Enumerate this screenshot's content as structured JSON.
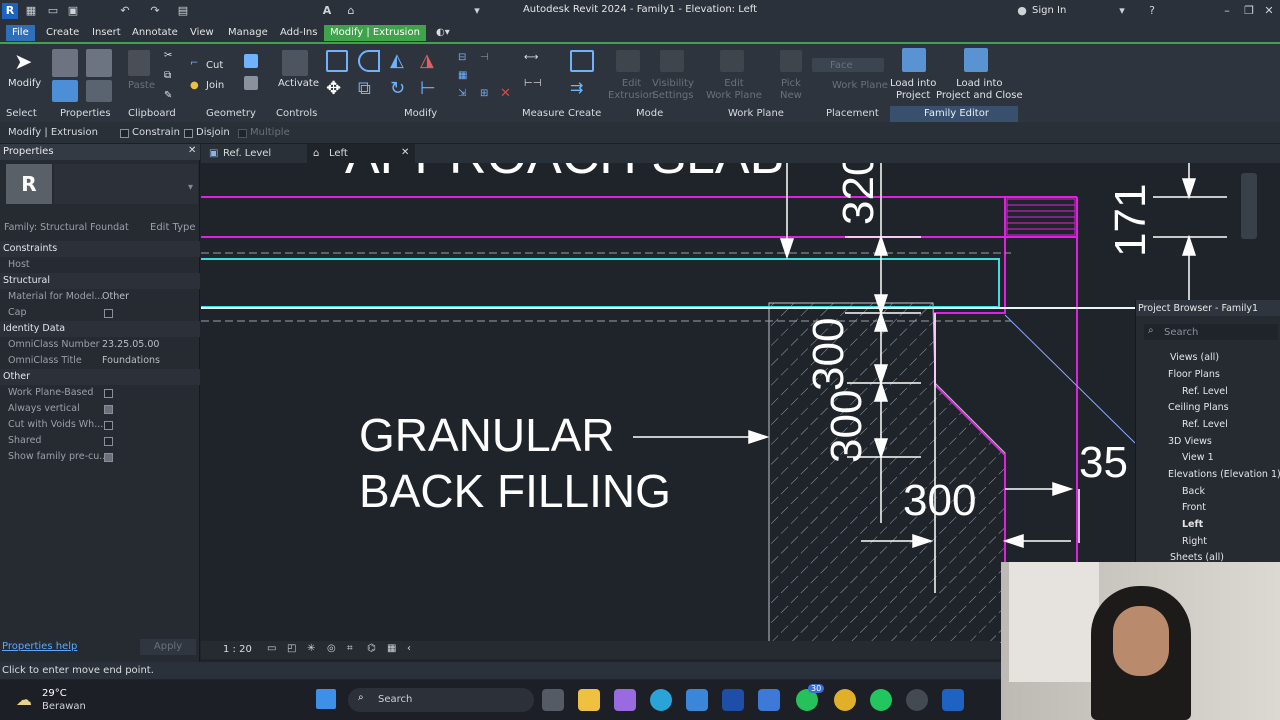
{
  "titlebar": {
    "title": "Autodesk Revit 2024 - Family1 - Elevation: Left",
    "sign_in": "Sign In",
    "app_letter": "R"
  },
  "menu": {
    "items": [
      "File",
      "Create",
      "Insert",
      "Annotate",
      "View",
      "Manage",
      "Add-Ins",
      "Modify | Extrusion"
    ]
  },
  "ribbon": {
    "groups": [
      "Select",
      "Properties",
      "Clipboard",
      "Geometry",
      "Controls",
      "Modify",
      "Measure",
      "Create",
      "Mode",
      "Work Plane",
      "Placement",
      "Family Editor"
    ],
    "modify": "Modify",
    "paste": "Paste",
    "cut": "Cut",
    "join": "Join",
    "activate": "Activate",
    "edit_extrusion": "Edit\nExtrusion",
    "visibility_settings": "Visibility\nSettings",
    "edit_work_plane": "Edit\nWork Plane",
    "pick_new": "Pick\nNew",
    "face": "Face",
    "work_plane": "Work Plane",
    "load_into_project": "Load into\nProject",
    "load_into_project_close": "Load into\nProject and Close"
  },
  "options": {
    "context": "Modify | Extrusion",
    "constrain": "Constrain",
    "disjoin": "Disjoin",
    "multiple": "Multiple"
  },
  "properties": {
    "title": "Properties",
    "type_selector": "Family: Structural Foundat",
    "edit_type": "Edit Type",
    "sections": [
      "Constraints",
      "Structural",
      "Identity Data",
      "Other"
    ],
    "host": "Host",
    "material": "Material for Model...",
    "material_val": "Other",
    "cap": "Cap",
    "omniclass_number": "OmniClass Number",
    "omniclass_number_val": "23.25.05.00",
    "omniclass_title": "OmniClass Title",
    "omniclass_title_val": "Foundations",
    "work_plane_based": "Work Plane-Based",
    "always_vertical": "Always vertical",
    "cut_with_voids": "Cut with Voids Wh...",
    "shared": "Shared",
    "show_family": "Show family pre-cu...",
    "help": "Properties help",
    "apply": "Apply"
  },
  "view_tabs": {
    "tab1": "Ref. Level",
    "tab2": "Left"
  },
  "drawing": {
    "heading": "APPROACH SLAB",
    "label_line1": "GRANULAR",
    "label_line2": "BACK FILLING",
    "dims": [
      "320",
      "171",
      "300",
      "300",
      "300",
      "35"
    ]
  },
  "view_control": {
    "scale": "1 : 20"
  },
  "project_browser": {
    "title": "Project Browser - Family1",
    "search_placeholder": "Search",
    "views_all": "Views (all)",
    "floor_plans": "Floor Plans",
    "fp_ref": "Ref. Level",
    "ceiling_plans": "Ceiling Plans",
    "cp_ref": "Ref. Level",
    "views_3d": "3D Views",
    "view1": "View 1",
    "elevations": "Elevations (Elevation 1)",
    "back": "Back",
    "front": "Front",
    "left": "Left",
    "right": "Right",
    "sheets": "Sheets (all)"
  },
  "status": {
    "message": "Click to enter move end point."
  },
  "taskbar": {
    "temp": "29°C",
    "weather": "Berawan",
    "search": "Search",
    "badge": "30"
  }
}
